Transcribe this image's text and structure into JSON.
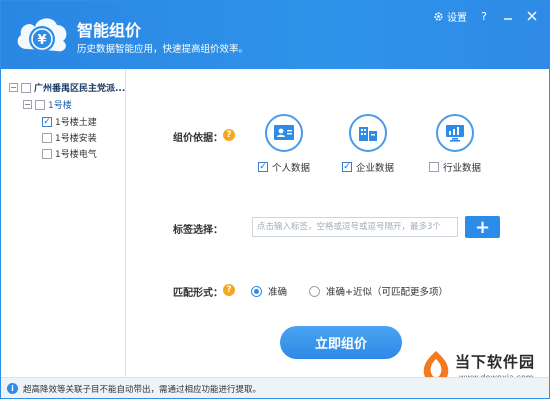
{
  "header": {
    "title": "智能组价",
    "subtitle": "历史数据智能应用，快速提高组价效率。",
    "settings_label": "设置",
    "help_label": "?"
  },
  "sidebar": {
    "root": {
      "label": "广州番禺区民主党派...",
      "expanded": true,
      "checked": false
    },
    "building": {
      "label": "1号楼",
      "expanded": true,
      "checked": false
    },
    "items": [
      {
        "label": "1号楼土建",
        "checked": true
      },
      {
        "label": "1号楼安装",
        "checked": false
      },
      {
        "label": "1号楼电气",
        "checked": false
      }
    ]
  },
  "basis": {
    "label": "组价依据：",
    "options": [
      {
        "label": "个人数据",
        "checked": true,
        "icon": "personal-data-icon"
      },
      {
        "label": "企业数据",
        "checked": true,
        "icon": "enterprise-data-icon"
      },
      {
        "label": "行业数据",
        "checked": false,
        "icon": "industry-data-icon"
      }
    ]
  },
  "tags": {
    "label": "标签选择：",
    "placeholder": "点击输入标签，空格或逗号或逗号隔开，最多3个",
    "add_label": "+"
  },
  "match": {
    "label": "匹配形式：",
    "options": [
      {
        "label": "准确",
        "selected": true
      },
      {
        "label": "准确+近似（可匹配更多项）",
        "selected": false
      }
    ]
  },
  "action": {
    "label": "立即组价"
  },
  "status": {
    "text": "超高降效等关联子目不能自动带出，需通过相应功能进行提取。"
  },
  "watermark": {
    "title": "当下软件园",
    "url": "www.downxia.com"
  },
  "colors": {
    "primary": "#2d8ce8",
    "header": "#2a86e3",
    "help": "#f6a623"
  }
}
